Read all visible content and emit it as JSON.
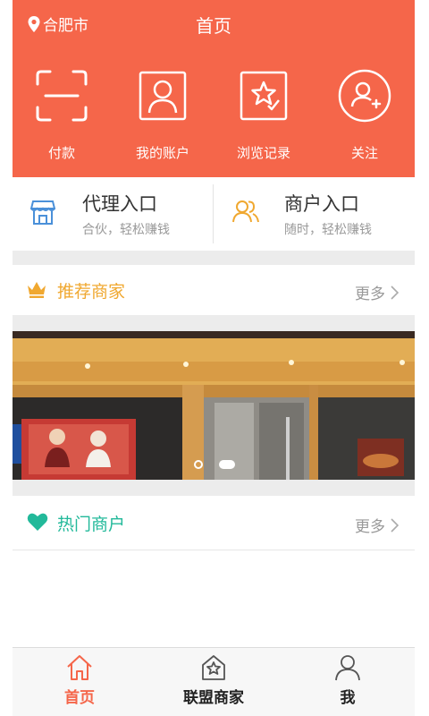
{
  "header": {
    "city": "合肥市",
    "title": "首页",
    "bg_color": "#f5664a",
    "actions": [
      {
        "label": "付款",
        "icon": "scan-icon"
      },
      {
        "label": "我的账户",
        "icon": "account-icon"
      },
      {
        "label": "浏览记录",
        "icon": "browse-history-icon"
      },
      {
        "label": "关注",
        "icon": "follow-icon"
      }
    ]
  },
  "entries": [
    {
      "title": "代理入口",
      "subtitle": "合伙，轻松赚钱",
      "icon": "store-icon"
    },
    {
      "title": "商户入口",
      "subtitle": "随时，轻松赚钱",
      "icon": "merchant-users-icon"
    }
  ],
  "recommended": {
    "title": "推荐商家",
    "more": "更多",
    "icon": "crown-icon",
    "color": "#f0a830"
  },
  "banner": {
    "slide_count": 2,
    "active_slide": 2
  },
  "hot": {
    "title": "热门商户",
    "more": "更多",
    "icon": "heart-icon",
    "color": "#22b99a"
  },
  "tabbar": {
    "active_color": "#f5664a",
    "tabs": [
      {
        "label": "首页",
        "icon": "home-icon",
        "active": true
      },
      {
        "label": "联盟商家",
        "icon": "alliance-merchant-icon",
        "active": false
      },
      {
        "label": "我",
        "icon": "profile-icon",
        "active": false
      }
    ]
  }
}
